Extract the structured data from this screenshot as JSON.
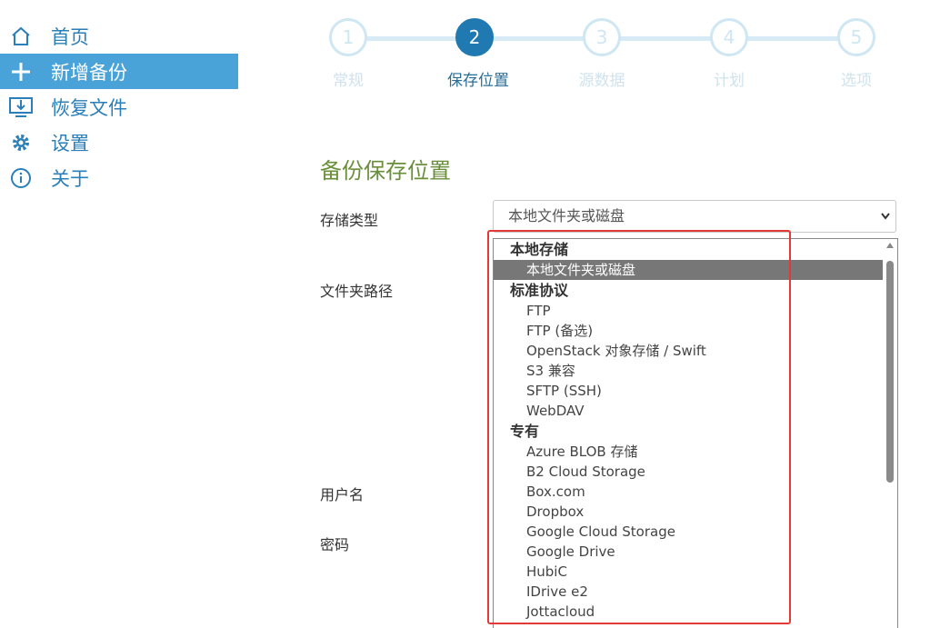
{
  "sidebar": {
    "items": [
      {
        "label": "首页",
        "icon": "home-icon"
      },
      {
        "label": "新增备份",
        "icon": "plus-icon"
      },
      {
        "label": "恢复文件",
        "icon": "restore-icon"
      },
      {
        "label": "设置",
        "icon": "gear-icon"
      },
      {
        "label": "关于",
        "icon": "info-icon"
      }
    ],
    "active_index": 1
  },
  "steps": [
    {
      "num": "1",
      "label": "常规"
    },
    {
      "num": "2",
      "label": "保存位置"
    },
    {
      "num": "3",
      "label": "源数据"
    },
    {
      "num": "4",
      "label": "计划"
    },
    {
      "num": "5",
      "label": "选项"
    }
  ],
  "active_step": 2,
  "section": {
    "title": "备份保存位置"
  },
  "fields": {
    "storage_type_label": "存储类型",
    "folder_path_label": "文件夹路径",
    "username_label": "用户名",
    "password_label": "密码"
  },
  "storage_select": {
    "value": "本地文件夹或磁盘"
  },
  "dropdown": {
    "groups": [
      {
        "label": "本地存储",
        "options": [
          "本地文件夹或磁盘"
        ]
      },
      {
        "label": "标准协议",
        "options": [
          "FTP",
          "FTP (备选)",
          "OpenStack 对象存储 / Swift",
          "S3 兼容",
          "SFTP (SSH)",
          "WebDAV"
        ]
      },
      {
        "label": "专有",
        "options": [
          "Azure BLOB 存储",
          "B2 Cloud Storage",
          "Box.com",
          "Dropbox",
          "Google Cloud Storage",
          "Google Drive",
          "HubiC",
          "IDrive e2",
          "Jottacloud"
        ]
      }
    ],
    "selected": "本地文件夹或磁盘"
  },
  "colors": {
    "accent": "#2079b0",
    "sidebar_active": "#4aa3d8",
    "title_green": "#6a8f3a",
    "highlight_box": "#e53935"
  }
}
